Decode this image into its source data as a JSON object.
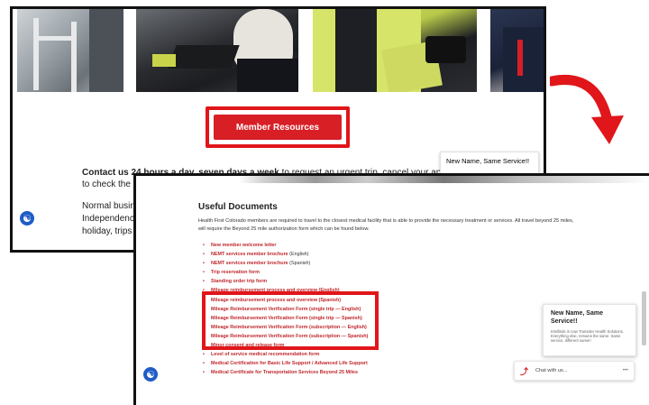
{
  "back_page": {
    "member_resources_button": "Member Resources",
    "contact_line1_bold": "Contact us 24 hours a day, seven days a week",
    "contact_line1_rest": " to request an urgent trip, cancel your appointm",
    "contact_line2": "to check the",
    "hours_line1": "Normal busin",
    "hours_line2": "Independenc",
    "hours_line3": "holiday, trips",
    "chat_mini_text": "New Name, Same Service!!"
  },
  "front_page": {
    "title": "Useful Documents",
    "intro": "Health First Colorado members are required to travel to the closest medical facility that is able to provide the necessary treatment or services.  All travel beyond 25 miles, will require the Beyond 25 mile authorization form which can be found below.",
    "documents": [
      {
        "label": "New member welcome letter",
        "suffix": ""
      },
      {
        "label": "NEMT services member brochure",
        "suffix": " (English)"
      },
      {
        "label": "NEMT services member brochure",
        "suffix": " (Spanish)"
      },
      {
        "label": "Trip reservation form",
        "suffix": ""
      },
      {
        "label": "Standing order trip form",
        "suffix": ""
      },
      {
        "label": "Mileage reimbursement process and overview (English)",
        "suffix": ""
      },
      {
        "label": "Mileage reimbursement process and overview (Spanish)",
        "suffix": ""
      },
      {
        "label": "Mileage Reimbursement Verification Form (single trip — English)",
        "suffix": ""
      },
      {
        "label": "Mileage Reimbursement Verification Form (single trip — Spanish)",
        "suffix": ""
      },
      {
        "label": "Mileage Reimbursement Verification Form (subscription — English)",
        "suffix": ""
      },
      {
        "label": "Mileage Reimbursement Verification Form (subscription — Spanish)",
        "suffix": ""
      },
      {
        "label": "Minor consent and release form",
        "suffix": ""
      },
      {
        "label": "Level of service medical recommendation form",
        "suffix": ""
      },
      {
        "label": "Medical Certification for Basic Life Support / Advanced Life Support",
        "suffix": ""
      },
      {
        "label": "Medical Certificate for Transportation Services Beyond 25 Miles",
        "suffix": ""
      }
    ],
    "chat_card_title": "New Name, Same Service!!",
    "chat_card_sub": "Intelliride is now Transdev Health Solutions. Everything else, remains the same. Same service, different name!!",
    "chat_bar_label": "Chat with us...",
    "chat_bar_more": "•••"
  },
  "colors": {
    "brand_red": "#d81f26",
    "highlight_red": "#e0161a",
    "accessibility_blue": "#1f5cc7"
  },
  "icons": [
    "accessibility-icon",
    "chat-icon",
    "curved-arrow-icon"
  ]
}
